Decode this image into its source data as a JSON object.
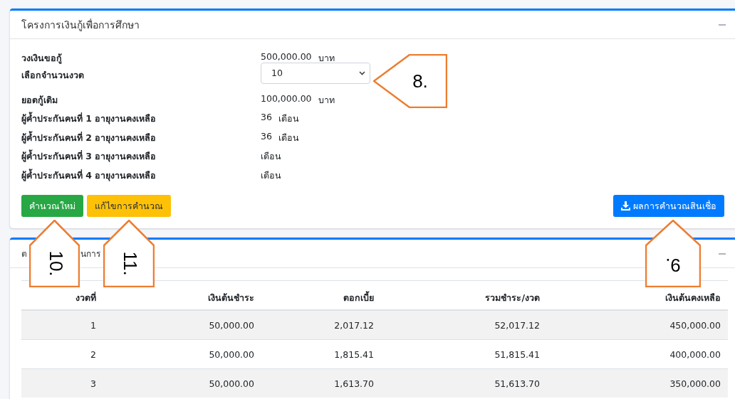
{
  "loan_card": {
    "title": "โครงการเงินกู้เพื่อการศึกษา",
    "fields": [
      {
        "kind": "text",
        "label": "วงเงินขอกู้",
        "value": "500,000.00",
        "unit": "บาท"
      },
      {
        "kind": "select",
        "label": "เลือกจำนวนงวด",
        "value": "10"
      },
      {
        "kind": "text",
        "label": "ยอดกู้เดิม",
        "value": "100,000.00",
        "unit": "บาท"
      },
      {
        "kind": "text",
        "label": "ผู้ค้ำประกันคนที่ 1 อายุงานคงเหลือ",
        "value": "36",
        "unit": "เดือน"
      },
      {
        "kind": "text",
        "label": "ผู้ค้ำประกันคนที่ 2 อายุงานคงเหลือ",
        "value": "36",
        "unit": "เดือน"
      },
      {
        "kind": "text",
        "label": "ผู้ค้ำประกันคนที่ 3 อายุงานคงเหลือ",
        "unit": "เดือน"
      },
      {
        "kind": "text",
        "label": "ผู้ค้ำประกันคนที่ 4 อายุงานคงเหลือ",
        "unit": "เดือน"
      }
    ],
    "buttons": [
      {
        "label": "คำนวณใหม่"
      },
      {
        "label": "แก้ไขการคำนวณ"
      },
      {
        "label": "ผลการคำนวณสินเชื่อ"
      }
    ]
  },
  "schedule_card": {
    "title_parts": [
      "ต",
      "นการ"
    ],
    "columns": [
      "งวดที่",
      "เงินต้นชำระ",
      "ดอกเบี้ย",
      "รวมชำระ/งวด",
      "เงินต้นคงเหลือ"
    ],
    "rows": [
      [
        "1",
        "50,000.00",
        "2,017.12",
        "52,017.12",
        "450,000.00"
      ],
      [
        "2",
        "50,000.00",
        "1,815.41",
        "51,815.41",
        "400,000.00"
      ],
      [
        "3",
        "50,000.00",
        "1,613.70",
        "51,613.70",
        "350,000.00"
      ]
    ]
  },
  "callouts": [
    {
      "label": "8."
    },
    {
      "label": "9."
    },
    {
      "label": "10."
    },
    {
      "label": "11."
    }
  ]
}
